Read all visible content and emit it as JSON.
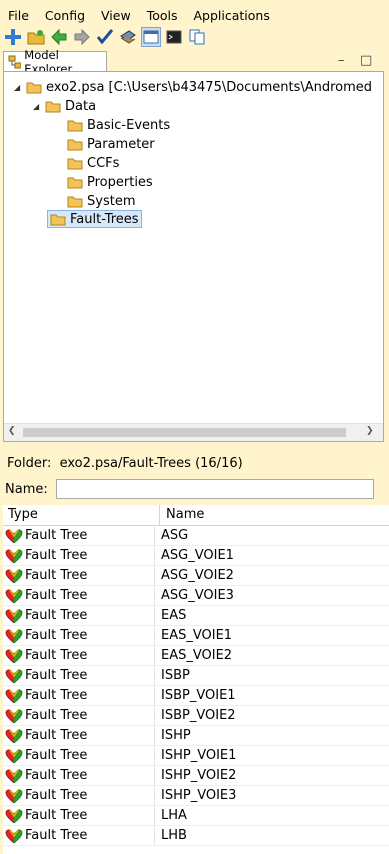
{
  "menu": [
    "File",
    "Config",
    "View",
    "Tools",
    "Applications"
  ],
  "toolbar": {
    "icons": [
      "add-icon",
      "new-folder-icon",
      "back-arrow-icon",
      "forward-arrow-icon",
      "check-icon",
      "database-icon",
      "window-icon",
      "console-icon",
      "copy-icon"
    ]
  },
  "explorer": {
    "tab_label": "Model Explorer",
    "root_label": "exo2.psa [C:\\Users\\b43475\\Documents\\Andromed",
    "data_label": "Data",
    "children": [
      "Basic-Events",
      "Parameter",
      "CCFs",
      "Properties",
      "System"
    ],
    "selected_label": "Fault-Trees"
  },
  "folder": {
    "label": "Folder:",
    "value": "exo2.psa/Fault-Trees (16/16)"
  },
  "name_field": {
    "label": "Name:",
    "value": ""
  },
  "table": {
    "columns": [
      "Type",
      "Name"
    ],
    "rows": [
      {
        "type": "Fault Tree",
        "name": "ASG"
      },
      {
        "type": "Fault Tree",
        "name": "ASG_VOIE1"
      },
      {
        "type": "Fault Tree",
        "name": "ASG_VOIE2"
      },
      {
        "type": "Fault Tree",
        "name": "ASG_VOIE3"
      },
      {
        "type": "Fault Tree",
        "name": "EAS"
      },
      {
        "type": "Fault Tree",
        "name": "EAS_VOIE1"
      },
      {
        "type": "Fault Tree",
        "name": "EAS_VOIE2"
      },
      {
        "type": "Fault Tree",
        "name": "ISBP"
      },
      {
        "type": "Fault Tree",
        "name": "ISBP_VOIE1"
      },
      {
        "type": "Fault Tree",
        "name": "ISBP_VOIE2"
      },
      {
        "type": "Fault Tree",
        "name": "ISHP"
      },
      {
        "type": "Fault Tree",
        "name": "ISHP_VOIE1"
      },
      {
        "type": "Fault Tree",
        "name": "ISHP_VOIE2"
      },
      {
        "type": "Fault Tree",
        "name": "ISHP_VOIE3"
      },
      {
        "type": "Fault Tree",
        "name": "LHA"
      },
      {
        "type": "Fault Tree",
        "name": "LHB"
      }
    ]
  }
}
